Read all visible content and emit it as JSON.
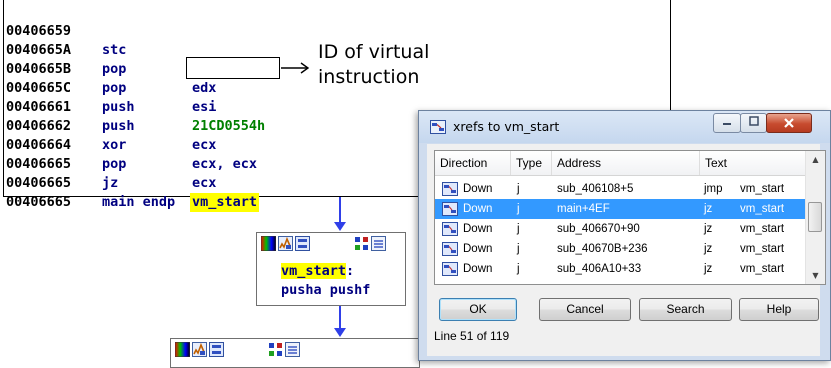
{
  "disassembly": {
    "lines": [
      {
        "address": "00406659",
        "mnemonic": "stc",
        "operands": ""
      },
      {
        "address": "0040665A",
        "mnemonic": "pop",
        "operands": "edx"
      },
      {
        "address": "0040665B",
        "mnemonic": "pop",
        "operands": "esi"
      },
      {
        "address": "0040665C",
        "mnemonic": "push",
        "operands": "21CD0554h"
      },
      {
        "address": "00406661",
        "mnemonic": "push",
        "operands": "ecx"
      },
      {
        "address": "00406662",
        "mnemonic": "xor",
        "operands": "ecx, ecx"
      },
      {
        "address": "00406664",
        "mnemonic": "pop",
        "operands": "ecx"
      },
      {
        "address": "00406665",
        "mnemonic": "jz",
        "operands": "vm_start"
      },
      {
        "address": "00406665",
        "mnemonic": "main endp",
        "operands": ""
      },
      {
        "address": "00406665",
        "mnemonic": "",
        "operands": ""
      }
    ],
    "annotation": "ID of virtual instruction",
    "colors": {
      "mnemonic": "#000080",
      "immediate": "#008000",
      "highlight": "#ffff00"
    }
  },
  "graph_node": {
    "label": "vm_start",
    "label_suffix": ":",
    "code": "pusha pushf",
    "toolbar_icons": [
      "color-palette-icon",
      "edit-icon",
      "graph-icon",
      "group-icon",
      "list-icon"
    ]
  },
  "xrefs_dialog": {
    "title": "xrefs to vm_start",
    "columns": [
      "Direction",
      "Type",
      "Address",
      "Text"
    ],
    "rows": [
      {
        "direction": "Down",
        "type": "j",
        "address": "sub_406108+5",
        "text_op": "jmp",
        "text_target": "vm_start",
        "selected": false
      },
      {
        "direction": "Down",
        "type": "j",
        "address": "main+4EF",
        "text_op": "jz",
        "text_target": "vm_start",
        "selected": true
      },
      {
        "direction": "Down",
        "type": "j",
        "address": "sub_406670+90",
        "text_op": "jz",
        "text_target": "vm_start",
        "selected": false
      },
      {
        "direction": "Down",
        "type": "j",
        "address": "sub_40670B+236",
        "text_op": "jz",
        "text_target": "vm_start",
        "selected": false
      },
      {
        "direction": "Down",
        "type": "j",
        "address": "sub_406A10+33",
        "text_op": "jz",
        "text_target": "vm_start",
        "selected": false
      }
    ],
    "buttons": {
      "ok": "OK",
      "cancel": "Cancel",
      "search": "Search",
      "help": "Help"
    },
    "status": "Line 51 of 119",
    "selection_color": "#3399ff"
  }
}
